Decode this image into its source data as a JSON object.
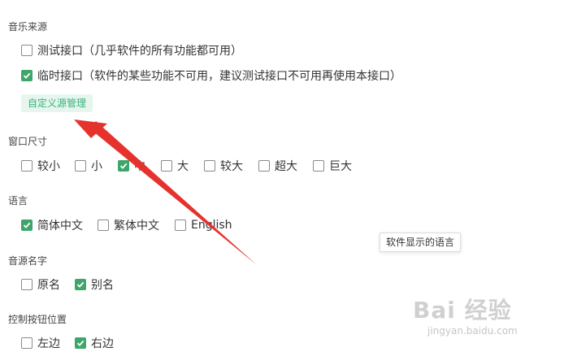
{
  "music_source": {
    "title": "音乐来源",
    "options": [
      {
        "label": "测试接口（几乎软件的所有功能都可用）",
        "checked": false
      },
      {
        "label": "临时接口（软件的某些功能不可用，建议测试接口不可用再使用本接口）",
        "checked": true
      }
    ],
    "custom_button": "自定义源管理"
  },
  "window_size": {
    "title": "窗口尺寸",
    "options": [
      {
        "label": "较小",
        "checked": false
      },
      {
        "label": "小",
        "checked": false
      },
      {
        "label": "中",
        "checked": true
      },
      {
        "label": "大",
        "checked": false
      },
      {
        "label": "较大",
        "checked": false
      },
      {
        "label": "超大",
        "checked": false
      },
      {
        "label": "巨大",
        "checked": false
      }
    ]
  },
  "language": {
    "title": "语言",
    "options": [
      {
        "label": "简体中文",
        "checked": true
      },
      {
        "label": "繁体中文",
        "checked": false
      },
      {
        "label": "English",
        "checked": false
      }
    ],
    "tooltip": "软件显示的语言"
  },
  "source_name": {
    "title": "音源名字",
    "options": [
      {
        "label": "原名",
        "checked": false
      },
      {
        "label": "别名",
        "checked": true
      }
    ]
  },
  "control_position": {
    "title": "控制按钮位置",
    "options": [
      {
        "label": "左边",
        "checked": false
      },
      {
        "label": "右边",
        "checked": true
      }
    ]
  },
  "watermark": {
    "main": "Bai 经验",
    "sub": "jingyan.baidu.com"
  },
  "colors": {
    "accent": "#3fa66b",
    "button_text": "#35b27a",
    "button_bg": "#e6f6ee",
    "arrow": "#e5322d"
  }
}
